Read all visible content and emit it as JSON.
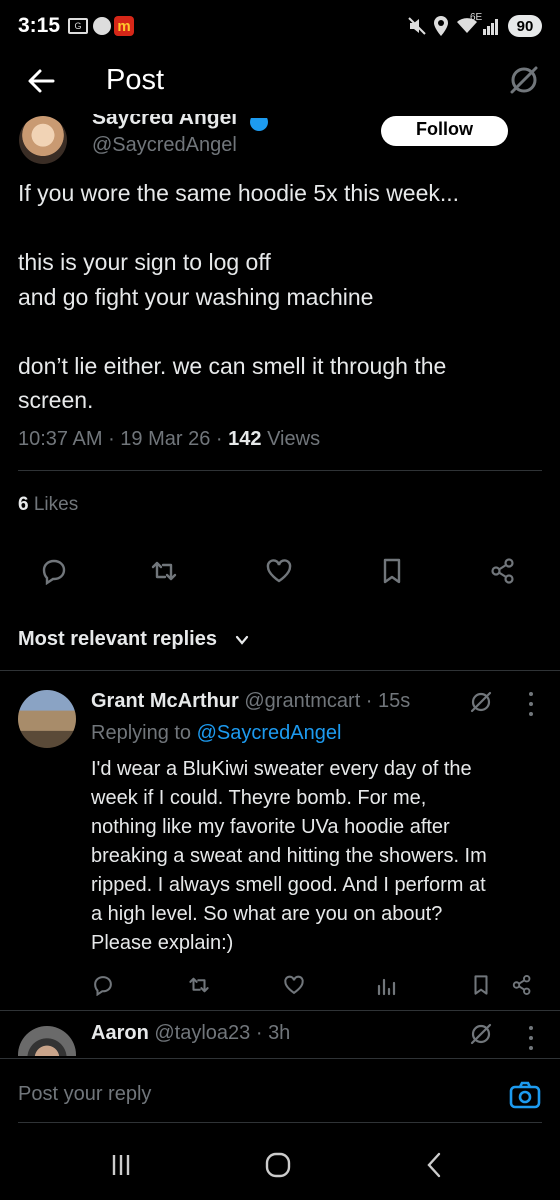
{
  "status_bar": {
    "time": "3:15",
    "network": "6E",
    "battery": "90"
  },
  "header": {
    "title": "Post"
  },
  "post": {
    "author_name": "Saycred Angel",
    "author_handle": "@SaycredAngel",
    "follow_label": "Follow",
    "text_lines": [
      "If you wore the same hoodie 5x this week...",
      "",
      "this is your sign to log off",
      "and go fight your washing machine",
      "",
      "don’t lie either. we can smell it through the",
      "screen."
    ],
    "time": "10:37 AM",
    "date": "19 Mar 26",
    "views_count": "142",
    "views_label": "Views",
    "likes_count": "6",
    "likes_label": "Likes"
  },
  "replies_section": {
    "label": "Most relevant replies"
  },
  "replies": [
    {
      "name": "Grant McArthur",
      "handle": "@grantmcart",
      "time": "15s",
      "replying_to_label": "Replying to",
      "replying_to_handle": "@SaycredAngel",
      "text_lines": [
        "I'd wear a BluKiwi sweater every day of the",
        "week if I could. Theyre bomb.  For me,",
        "nothing like my favorite UVa hoodie after",
        "breaking a sweat and hitting the showers. Im",
        "ripped. I always smell good. And I perform at",
        "a high level. So what are you on about?",
        "Please explain:)"
      ]
    },
    {
      "name": "Aaron",
      "handle": "@tayloa23",
      "time": "3h"
    }
  ],
  "compose": {
    "placeholder": "Post your reply"
  },
  "icons": {
    "accent": "#1d9bf0",
    "follow_bg": "#ffffff",
    "background": "#000000"
  }
}
